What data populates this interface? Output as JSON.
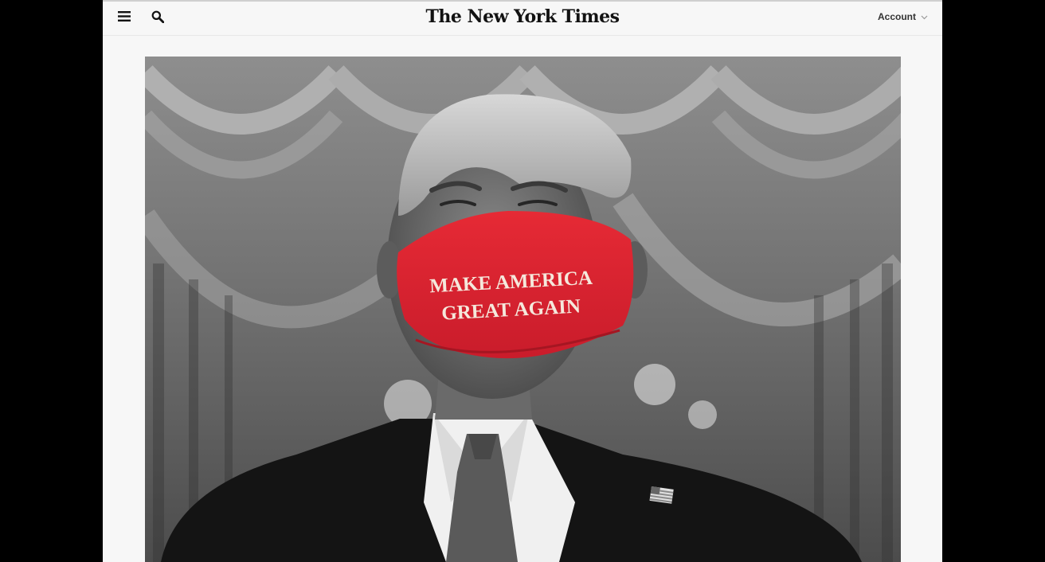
{
  "masthead": {
    "logo_text": "The New York Times",
    "account_label": "Account",
    "icons": {
      "menu": "hamburger-menu-icon",
      "search": "search-icon",
      "account_chevron": "chevron-down-icon"
    }
  },
  "hero": {
    "mask_line_1": "MAKE AMERICA",
    "mask_line_2": "GREAT AGAIN",
    "colors": {
      "mask_red": "#d9202f",
      "mask_text": "#f5e8dc"
    }
  },
  "colors": {
    "page_background": "#f7f7f7",
    "frame_background": "#000000",
    "text_dark": "#121212"
  }
}
